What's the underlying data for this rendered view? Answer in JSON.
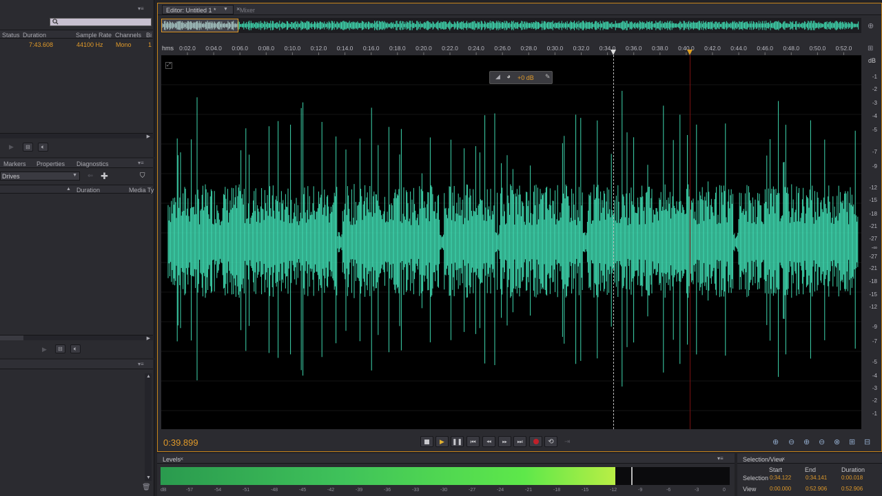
{
  "files_panel": {
    "search_placeholder": "",
    "columns": [
      "Status",
      "Duration",
      "Sample Rate",
      "Channels",
      "Bi"
    ],
    "row": {
      "duration": "7:43.608",
      "sample_rate": "44100 Hz",
      "channels": "Mono",
      "bits": "1"
    }
  },
  "markers_panel": {
    "tabs": [
      "Markers",
      "Properties",
      "Diagnostics"
    ],
    "drives_label": "Drives",
    "columns": [
      "Duration",
      "Media Ty"
    ]
  },
  "editor": {
    "tab_label": "Editor: Untitled 1 *",
    "mixer_tab": "Mixer",
    "timeline_unit": "hms",
    "ticks": [
      "0:02.0",
      "0:04.0",
      "0:06.0",
      "0:08.0",
      "0:10.0",
      "0:12.0",
      "0:14.0",
      "0:16.0",
      "0:18.0",
      "0:20.0",
      "0:22.0",
      "0:24.0",
      "0:26.0",
      "0:28.0",
      "0:30.0",
      "0:32.0",
      "0:34.0",
      "0:36.0",
      "0:38.0",
      "0:40.0",
      "0:42.0",
      "0:44.0",
      "0:46.0",
      "0:48.0",
      "0:50.0",
      "0:52.0"
    ],
    "db_unit": "dB",
    "db_ticks": [
      "-1",
      "-2",
      "-3",
      "-4",
      "-5",
      "-7",
      "-9",
      "-12",
      "-15",
      "-18",
      "-21",
      "-27",
      "-∞",
      "-27",
      "-21",
      "-18",
      "-15",
      "-12",
      "-9",
      "-7",
      "-5",
      "-4",
      "-3",
      "-2",
      "-1"
    ],
    "hud_volume": "+0 dB",
    "playhead_time": "0:39.899",
    "waveform_color": "#3fd9b0"
  },
  "levels": {
    "title": "Levels",
    "scale": [
      "dB",
      "-57",
      "-54",
      "-51",
      "-48",
      "-45",
      "-42",
      "-39",
      "-36",
      "-33",
      "-30",
      "-27",
      "-24",
      "-21",
      "-18",
      "-15",
      "-12",
      "-9",
      "-6",
      "-3",
      "0"
    ]
  },
  "selection_view": {
    "title": "Selection/View",
    "headers": [
      "Start",
      "End",
      "Duration"
    ],
    "rows": [
      {
        "label": "Selection",
        "start": "0:34.122",
        "end": "0:34.141",
        "duration": "0:00.018"
      },
      {
        "label": "View",
        "start": "0:00.000",
        "end": "0:52.906",
        "duration": "0:52.906"
      }
    ]
  }
}
